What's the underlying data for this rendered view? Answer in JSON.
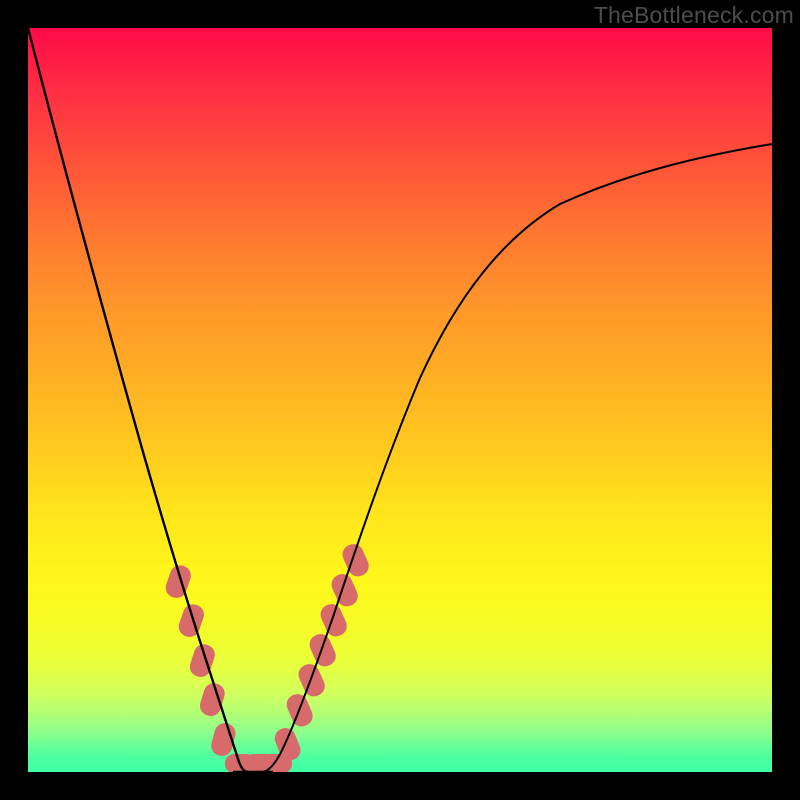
{
  "watermark": "TheBottleneck.com",
  "colors": {
    "frame": "#000000",
    "curve": "#000000",
    "pill": "#d76a6a",
    "gradient_top": "#ff0b48",
    "gradient_bottom": "#3effa4"
  },
  "chart_data": {
    "type": "line",
    "title": "",
    "xlabel": "",
    "ylabel": "",
    "xlim": [
      0,
      1
    ],
    "ylim": [
      0,
      1
    ],
    "note": "No numeric axis labels are visible; values below are normalized 0-1 (x left→right, y bottom→top) estimated from pixel positions.",
    "series": [
      {
        "name": "left-branch",
        "x": [
          0.0,
          0.05,
          0.1,
          0.15,
          0.19,
          0.216,
          0.237,
          0.254,
          0.267,
          0.276,
          0.283,
          0.29,
          0.297,
          0.305,
          0.314
        ],
        "y": [
          1.0,
          0.806,
          0.618,
          0.441,
          0.3,
          0.208,
          0.134,
          0.074,
          0.028,
          0.0,
          0.0,
          0.0,
          0.0,
          0.0,
          0.0
        ]
      },
      {
        "name": "right-branch",
        "x": [
          0.314,
          0.321,
          0.329,
          0.341,
          0.355,
          0.372,
          0.392,
          0.417,
          0.447,
          0.483,
          0.524,
          0.57,
          0.621,
          0.676,
          0.735,
          0.797,
          0.862,
          0.929,
          0.997
        ],
        "y": [
          0.0,
          0.0,
          0.0,
          0.021,
          0.06,
          0.11,
          0.17,
          0.245,
          0.335,
          0.444,
          0.524,
          0.591,
          0.649,
          0.698,
          0.739,
          0.774,
          0.802,
          0.825,
          0.844
        ]
      }
    ],
    "markers": {
      "name": "highlight-pills",
      "x": [
        0.201,
        0.216,
        0.231,
        0.245,
        0.26,
        0.276,
        0.293,
        0.31,
        0.327,
        0.343,
        0.358,
        0.372,
        0.386,
        0.4,
        0.414
      ],
      "y": [
        0.261,
        0.208,
        0.155,
        0.102,
        0.049,
        0.0,
        0.0,
        0.0,
        0.0,
        0.028,
        0.07,
        0.11,
        0.152,
        0.194,
        0.235
      ]
    }
  }
}
